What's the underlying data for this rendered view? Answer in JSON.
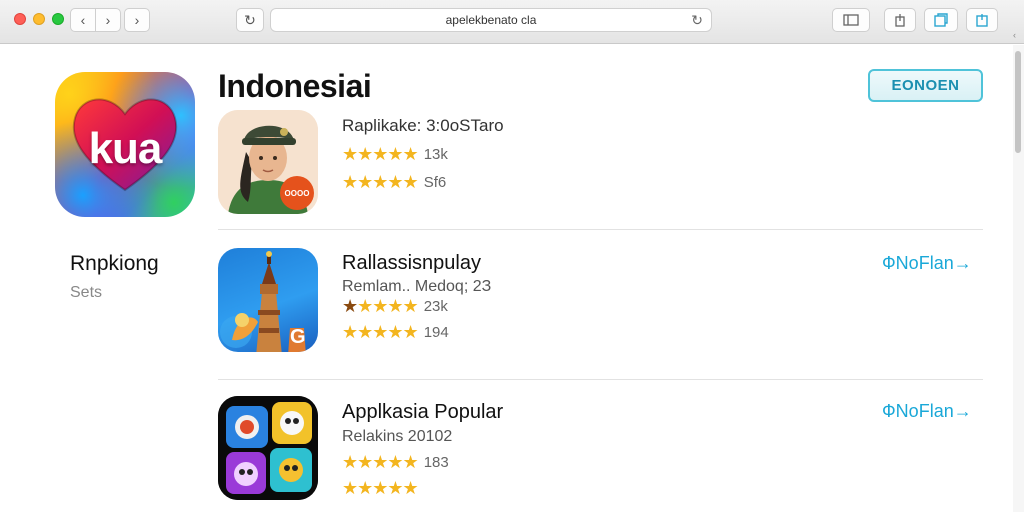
{
  "browser": {
    "url": "apelekbenato cla",
    "traffic_colors": [
      "#fe5f57",
      "#febc2e",
      "#28c840"
    ],
    "icons": {
      "back": "chevron-left-icon",
      "forward": "chevron-right-icon",
      "next": "chevron-right-icon",
      "reload": "reload-icon",
      "sidebar": "sidebar-icon",
      "share": "share-icon",
      "tabs": "tabs-icon",
      "copy": "copy-icon"
    }
  },
  "sidebar": {
    "app_icon_text": "kua",
    "title": "Rnpkiong",
    "subtitle": "Sets"
  },
  "main": {
    "title": "Indonesiai",
    "top_button": "EONOEN",
    "accent": "#1aa8d8",
    "star_color": "#f3b51f",
    "items": [
      {
        "title": "",
        "subtitle": "Raplikake: 3:0oSTaro",
        "ratings": [
          {
            "stars": 5,
            "count": "13k"
          },
          {
            "stars": 5,
            "count": "Sf6"
          }
        ],
        "icon_badge": "OOOO",
        "link": ""
      },
      {
        "title": "Rallassisnpulay",
        "subtitle": "Remlam..  Medoq; 2З",
        "ratings": [
          {
            "stars": 5,
            "count": "23k"
          },
          {
            "stars": 5,
            "count": "194"
          }
        ],
        "icon_badge": "G",
        "link": "ФNoFlan→"
      },
      {
        "title": "Applkasia Popular",
        "subtitle": "Relakins 20102",
        "ratings": [
          {
            "stars": 5,
            "count": "183"
          },
          {
            "stars": 5,
            "count": ""
          }
        ],
        "link": "ФNoFlan→"
      }
    ]
  }
}
